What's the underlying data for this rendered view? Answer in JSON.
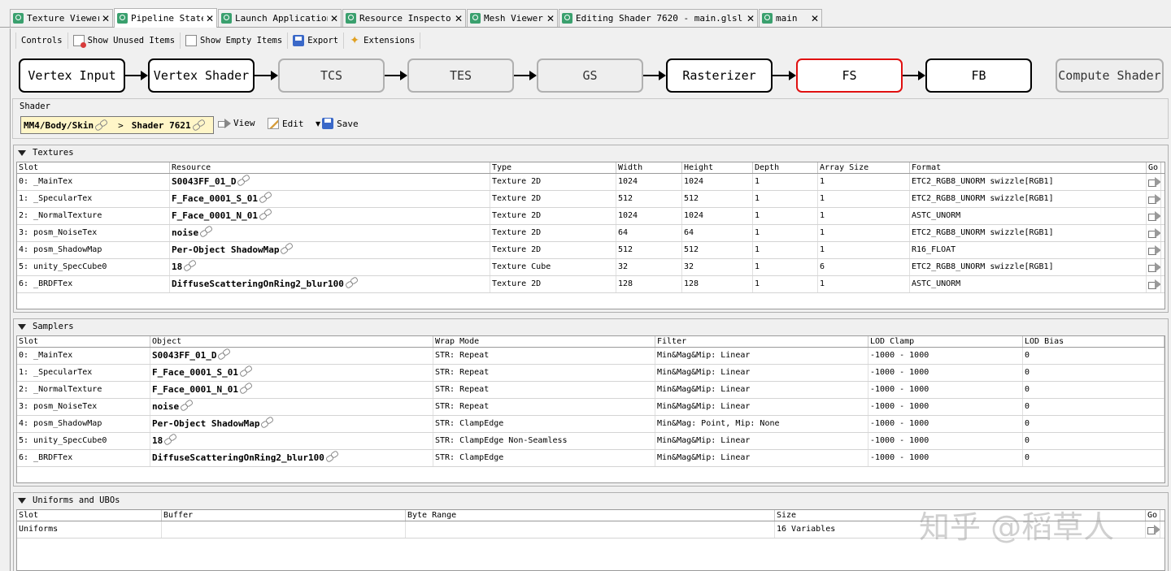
{
  "tabs": [
    {
      "label": "Texture Viewer"
    },
    {
      "label": "Pipeline State"
    },
    {
      "label": "Launch Application"
    },
    {
      "label": "Resource Inspector"
    },
    {
      "label": "Mesh Viewer"
    },
    {
      "label": "Editing Shader 7620 - main.glsl -"
    },
    {
      "label": "main"
    }
  ],
  "toolbar": {
    "controls": "Controls",
    "show_unused": "Show Unused Items",
    "show_empty": "Show Empty Items",
    "export": "Export",
    "extensions": "Extensions"
  },
  "pipeline": {
    "stages": [
      "Vertex Input",
      "Vertex Shader",
      "TCS",
      "TES",
      "GS",
      "Rasterizer",
      "FS",
      "FB"
    ],
    "compute": "Compute Shader",
    "selected": "FS",
    "disabled": [
      "TCS",
      "TES",
      "GS"
    ]
  },
  "shader": {
    "group_title": "Shader",
    "path": "MM4/Body/Skin",
    "separator": ">",
    "name": "Shader 7621",
    "view": "View",
    "edit": "Edit",
    "save": "Save"
  },
  "textures": {
    "title": "Textures",
    "columns": [
      "Slot",
      "Resource",
      "Type",
      "Width",
      "Height",
      "Depth",
      "Array Size",
      "Format",
      "Go"
    ],
    "rows": [
      [
        "0: _MainTex",
        "S0043FF_01_D",
        "Texture 2D",
        "1024",
        "1024",
        "1",
        "1",
        "ETC2_RGB8_UNORM swizzle[RGB1]"
      ],
      [
        "1: _SpecularTex",
        "F_Face_0001_S_01",
        "Texture 2D",
        "512",
        "512",
        "1",
        "1",
        "ETC2_RGB8_UNORM swizzle[RGB1]"
      ],
      [
        "2: _NormalTexture",
        "F_Face_0001_N_01",
        "Texture 2D",
        "1024",
        "1024",
        "1",
        "1",
        "ASTC_UNORM"
      ],
      [
        "3: posm_NoiseTex",
        "noise",
        "Texture 2D",
        "64",
        "64",
        "1",
        "1",
        "ETC2_RGB8_UNORM swizzle[RGB1]"
      ],
      [
        "4: posm_ShadowMap",
        "Per-Object ShadowMap",
        "Texture 2D",
        "512",
        "512",
        "1",
        "1",
        "R16_FLOAT"
      ],
      [
        "5: unity_SpecCube0",
        "18",
        "Texture Cube",
        "32",
        "32",
        "1",
        "6",
        "ETC2_RGB8_UNORM swizzle[RGB1]"
      ],
      [
        "6: _BRDFTex",
        "DiffuseScatteringOnRing2_blur100",
        "Texture 2D",
        "128",
        "128",
        "1",
        "1",
        "ASTC_UNORM"
      ]
    ]
  },
  "samplers": {
    "title": "Samplers",
    "columns": [
      "Slot",
      "Object",
      "Wrap Mode",
      "Filter",
      "LOD Clamp",
      "LOD Bias"
    ],
    "rows": [
      [
        "0: _MainTex",
        "S0043FF_01_D",
        "STR: Repeat",
        "Min&Mag&Mip: Linear",
        "-1000 - 1000",
        "0"
      ],
      [
        "1: _SpecularTex",
        "F_Face_0001_S_01",
        "STR: Repeat",
        "Min&Mag&Mip: Linear",
        "-1000 - 1000",
        "0"
      ],
      [
        "2: _NormalTexture",
        "F_Face_0001_N_01",
        "STR: Repeat",
        "Min&Mag&Mip: Linear",
        "-1000 - 1000",
        "0"
      ],
      [
        "3: posm_NoiseTex",
        "noise",
        "STR: Repeat",
        "Min&Mag&Mip: Linear",
        "-1000 - 1000",
        "0"
      ],
      [
        "4: posm_ShadowMap",
        "Per-Object ShadowMap",
        "STR: ClampEdge",
        "Min&Mag: Point, Mip: None",
        "-1000 - 1000",
        "0"
      ],
      [
        "5: unity_SpecCube0",
        "18",
        "STR: ClampEdge Non-Seamless",
        "Min&Mag&Mip: Linear",
        "-1000 - 1000",
        "0"
      ],
      [
        "6: _BRDFTex",
        "DiffuseScatteringOnRing2_blur100",
        "STR: ClampEdge",
        "Min&Mag&Mip: Linear",
        "-1000 - 1000",
        "0"
      ]
    ]
  },
  "uniforms": {
    "title": "Uniforms and UBOs",
    "columns": [
      "Slot",
      "Buffer",
      "Byte Range",
      "Size",
      "Go"
    ],
    "rows": [
      [
        "Uniforms",
        "",
        "",
        "16 Variables"
      ]
    ]
  },
  "watermark": "知乎 @稻草人",
  "colors": {
    "selected_stage_border": "#e01010",
    "tab_icon": "#3aa06e",
    "shader_path_bg": "#fff6c8"
  }
}
